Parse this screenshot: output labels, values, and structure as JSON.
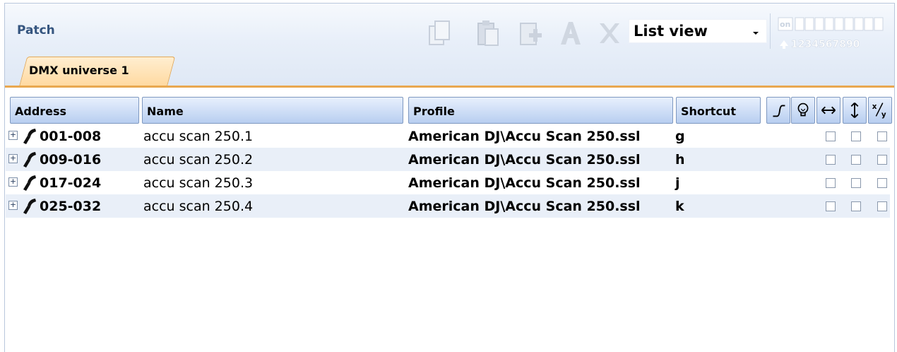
{
  "panel": {
    "title": "Patch"
  },
  "toolbar": {
    "icons": [
      "copy-icon",
      "paste-icon",
      "add-icon",
      "rename-icon",
      "delete-icon"
    ],
    "view_select": {
      "value": "List view"
    },
    "dmx_indicator": {
      "on_label": "on",
      "digits": "1234567890"
    }
  },
  "tabs": [
    {
      "label": "DMX universe 1",
      "active": true
    }
  ],
  "columns": {
    "address": "Address",
    "name": "Name",
    "profile": "Profile",
    "shortcut": "Shortcut",
    "icon_columns": [
      "curve-icon",
      "bulb-icon",
      "horizontal-swap-icon",
      "vertical-swap-icon",
      "xy-swap-icon"
    ]
  },
  "rows": [
    {
      "address": "001-008",
      "name": "accu scan 250.1",
      "profile": "American DJ\\Accu Scan 250.ssl",
      "shortcut": "g"
    },
    {
      "address": "009-016",
      "name": "accu scan 250.2",
      "profile": "American DJ\\Accu Scan 250.ssl",
      "shortcut": "h"
    },
    {
      "address": "017-024",
      "name": "accu scan 250.3",
      "profile": "American DJ\\Accu Scan 250.ssl",
      "shortcut": "j"
    },
    {
      "address": "025-032",
      "name": "accu scan 250.4",
      "profile": "American DJ\\Accu Scan 250.ssl",
      "shortcut": "k"
    }
  ],
  "colors": {
    "accent": "#e9a850",
    "header_blue": "#b8cef0",
    "title": "#35557f",
    "row_alt": "#e9eff8"
  }
}
